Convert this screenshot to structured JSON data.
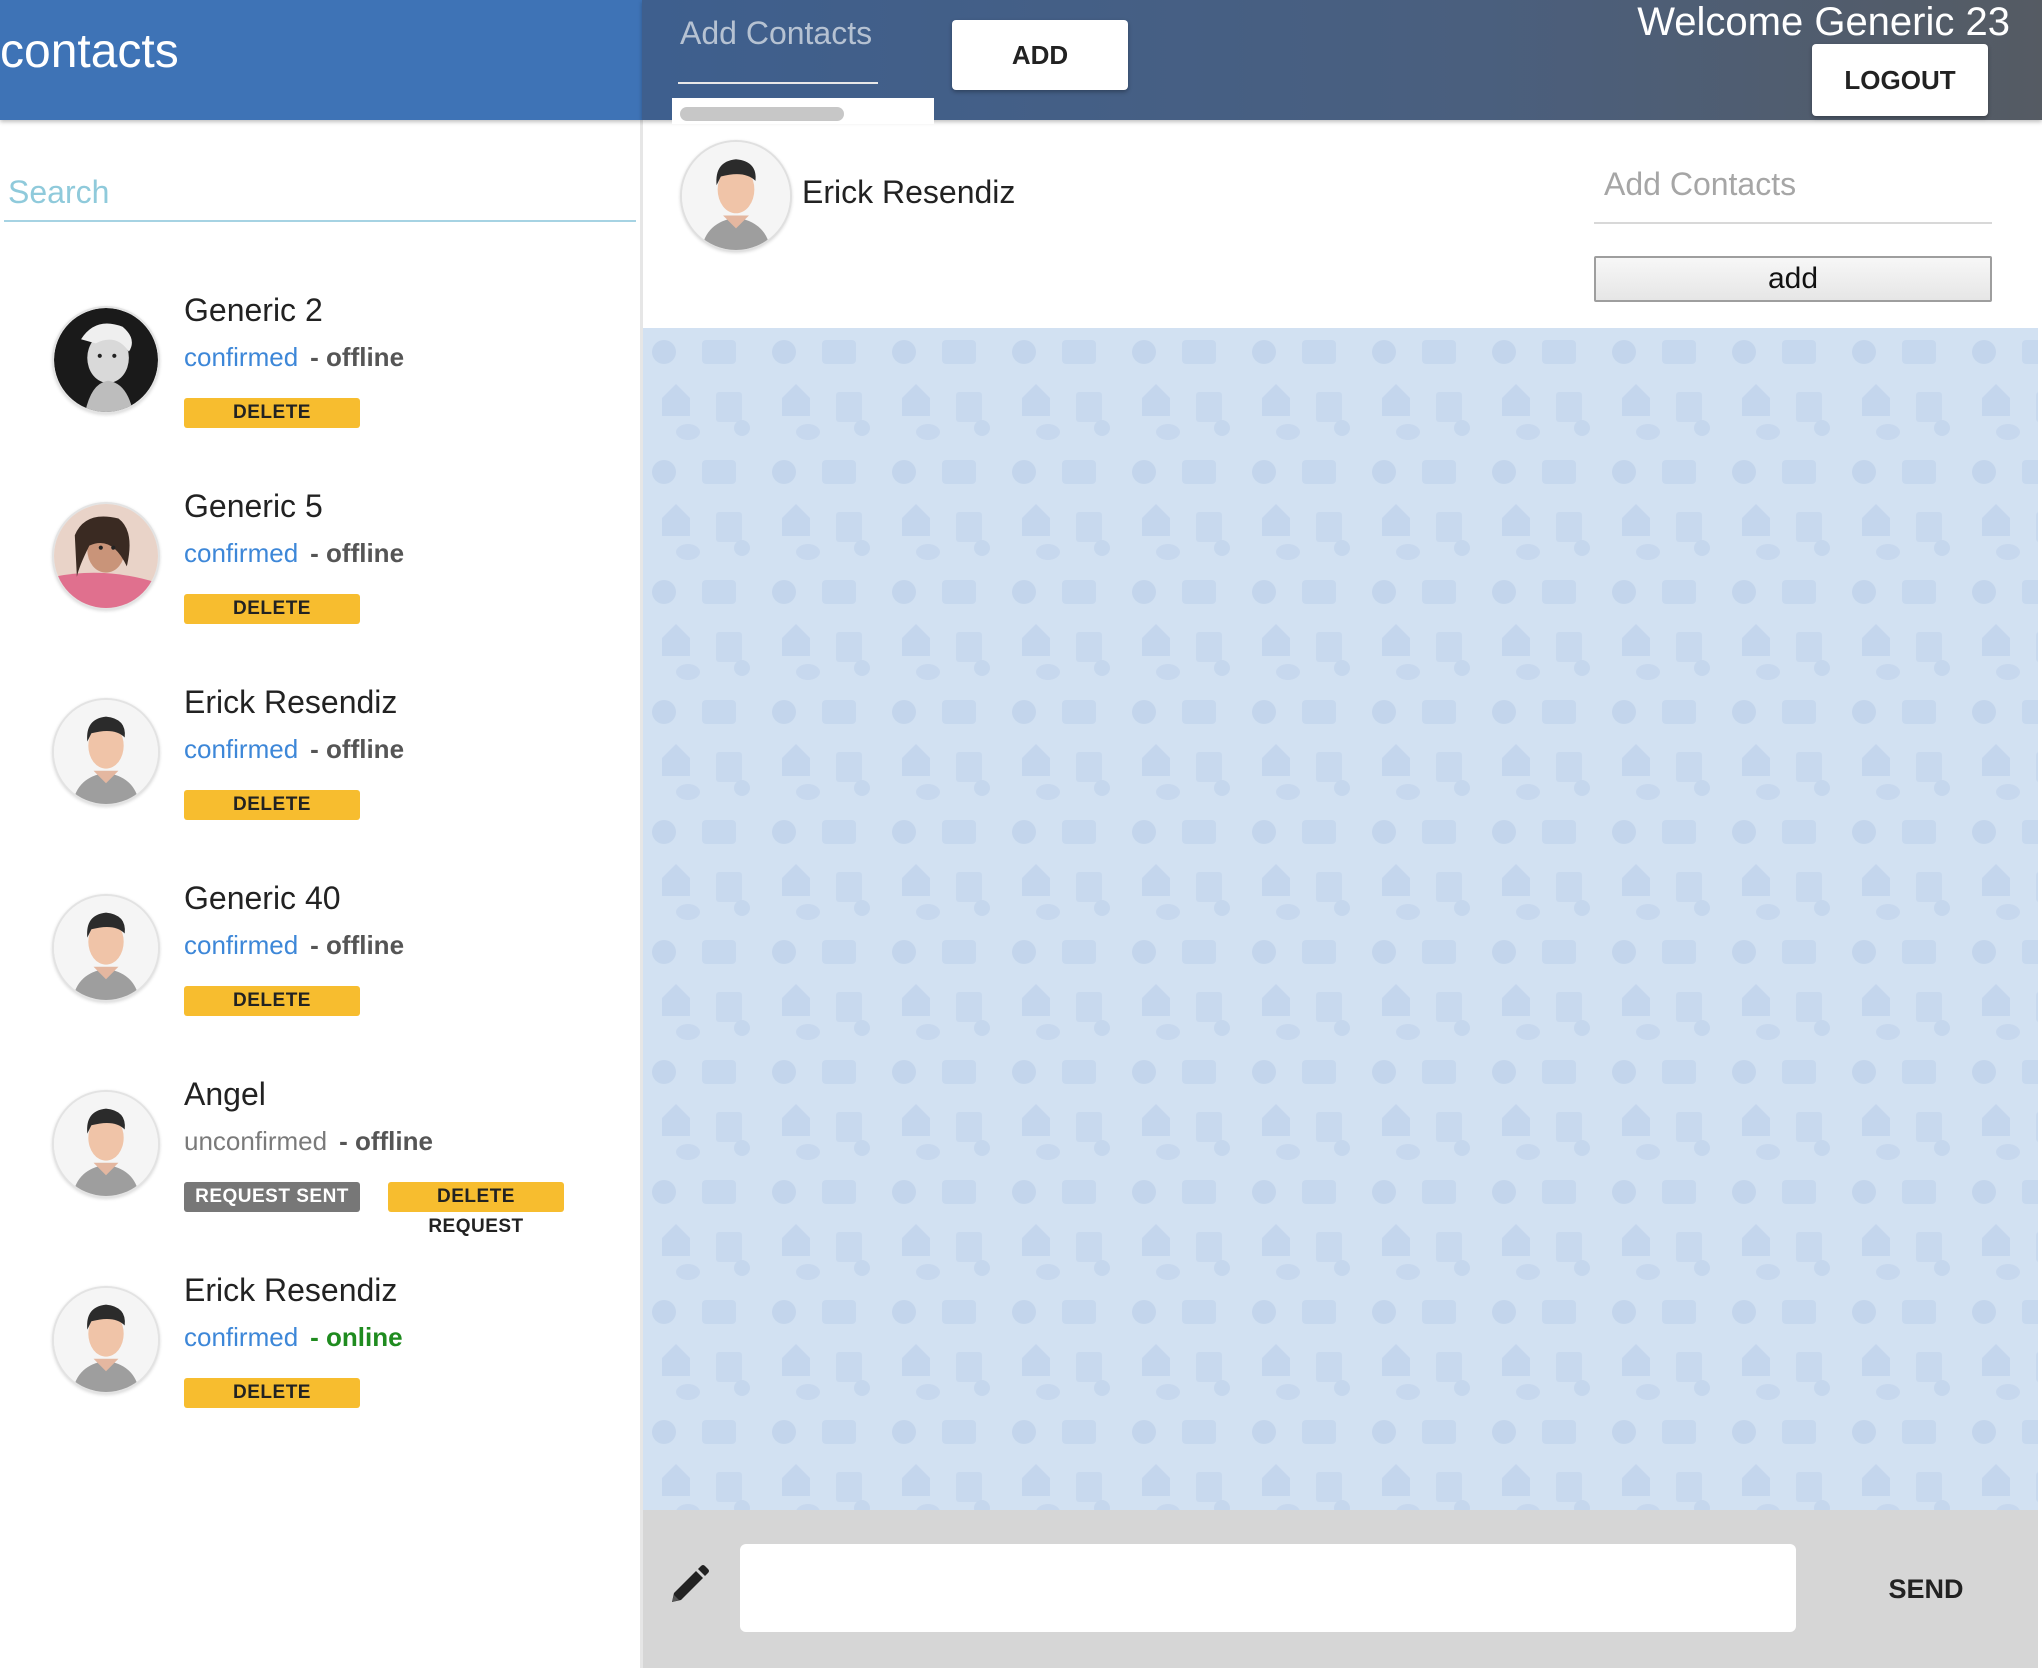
{
  "sidebar": {
    "title": "contacts",
    "search_placeholder": "Search",
    "contacts": [
      {
        "name": "Generic 2",
        "status": "confirmed",
        "presence": "- offline",
        "action": "DELETE"
      },
      {
        "name": "Generic 5",
        "status": "confirmed",
        "presence": "- offline",
        "action": "DELETE"
      },
      {
        "name": "Erick Resendiz",
        "status": "confirmed",
        "presence": "- offline",
        "action": "DELETE"
      },
      {
        "name": "Generic 40",
        "status": "confirmed",
        "presence": "- offline",
        "action": "DELETE"
      },
      {
        "name": "Angel",
        "status": "unconfirmed",
        "presence": "- offline",
        "action": "REQUEST SENT",
        "action2": "DELETE REQUEST"
      },
      {
        "name": "Erick Resendiz",
        "status": "confirmed",
        "presence": "- online",
        "action": "DELETE"
      }
    ]
  },
  "topbar": {
    "add_contacts_placeholder": "Add Contacts",
    "add_label": "ADD",
    "welcome": "Welcome Generic 23",
    "logout_label": "LOGOUT"
  },
  "chat": {
    "contact_name": "Erick Resendiz",
    "add_contacts_placeholder": "Add Contacts",
    "add_label": "add",
    "message_value": "",
    "send_label": "SEND"
  },
  "colors": {
    "sidebar_header": "#3e73b6",
    "confirmed": "#3d87d8",
    "online": "#1f8b1f",
    "delete_badge": "#f7bd2f",
    "request_badge": "#777777",
    "chat_background": "#d2e1f2"
  },
  "icons": {
    "composer": "pencil-icon",
    "default_avatar": "user-avatar-icon"
  }
}
